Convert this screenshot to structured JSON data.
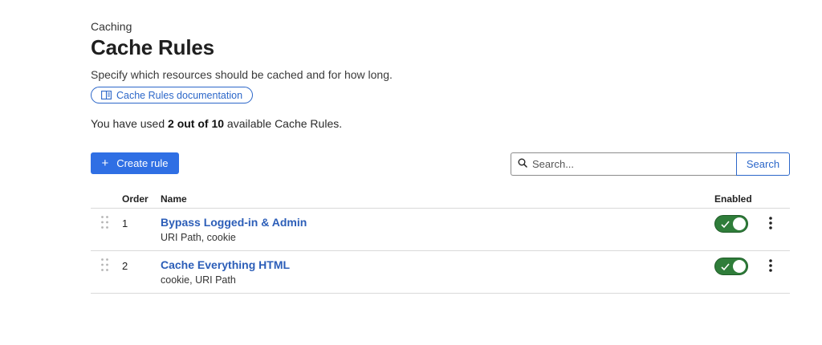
{
  "header": {
    "eyebrow": "Caching",
    "title": "Cache Rules",
    "subtitle": "Specify which resources should be cached and for how long.",
    "doc_link": "Cache Rules documentation"
  },
  "usage": {
    "prefix": "You have used ",
    "count": "2 out of 10",
    "suffix": " available Cache Rules."
  },
  "toolbar": {
    "create_label": "Create rule",
    "search_placeholder": "Search...",
    "search_button": "Search"
  },
  "table": {
    "columns": {
      "order": "Order",
      "name": "Name",
      "enabled": "Enabled"
    },
    "rows": [
      {
        "order": "1",
        "name": "Bypass Logged-in & Admin",
        "desc": "URI Path, cookie",
        "enabled": true
      },
      {
        "order": "2",
        "name": "Cache Everything HTML",
        "desc": "cookie, URI Path",
        "enabled": true
      }
    ]
  },
  "colors": {
    "accent": "#2f6fe4",
    "link": "#2c5eb8",
    "toggle_on": "#2f7d3a"
  }
}
